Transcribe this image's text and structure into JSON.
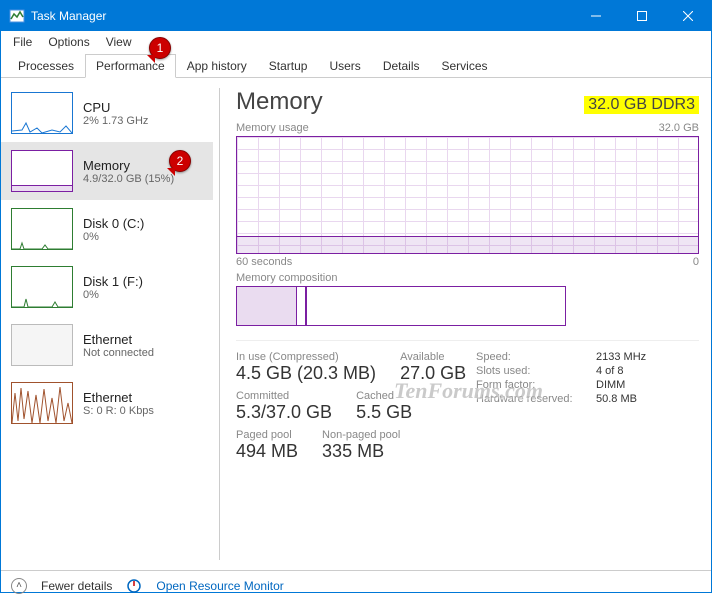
{
  "window": {
    "title": "Task Manager"
  },
  "menus": [
    "File",
    "Options",
    "View"
  ],
  "tabs": [
    "Processes",
    "Performance",
    "App history",
    "Startup",
    "Users",
    "Details",
    "Services"
  ],
  "active_tab": 1,
  "sidebar": [
    {
      "name": "CPU",
      "sub": "2% 1.73 GHz",
      "color": "blue"
    },
    {
      "name": "Memory",
      "sub": "4.9/32.0 GB (15%)",
      "color": "purple",
      "selected": true
    },
    {
      "name": "Disk 0 (C:)",
      "sub": "0%",
      "color": "green"
    },
    {
      "name": "Disk 1 (F:)",
      "sub": "0%",
      "color": "green"
    },
    {
      "name": "Ethernet",
      "sub": "Not connected",
      "color": "gray"
    },
    {
      "name": "Ethernet",
      "sub": "S: 0 R: 0 Kbps",
      "color": "orange"
    }
  ],
  "main": {
    "title": "Memory",
    "capacity": "32.0 GB DDR3",
    "usage_label": "Memory usage",
    "usage_max": "32.0 GB",
    "axis_left": "60 seconds",
    "axis_right": "0",
    "composition_label": "Memory composition"
  },
  "stats": {
    "inuse_label": "In use (Compressed)",
    "inuse_val": "4.5 GB (20.3 MB)",
    "available_label": "Available",
    "available_val": "27.0 GB",
    "committed_label": "Committed",
    "committed_val": "5.3/37.0 GB",
    "cached_label": "Cached",
    "cached_val": "5.5 GB",
    "paged_label": "Paged pool",
    "paged_val": "494 MB",
    "nonpaged_label": "Non-paged pool",
    "nonpaged_val": "335 MB"
  },
  "info": {
    "speed_k": "Speed:",
    "speed_v": "2133 MHz",
    "slots_k": "Slots used:",
    "slots_v": "4 of 8",
    "form_k": "Form factor:",
    "form_v": "DIMM",
    "hw_k": "Hardware reserved:",
    "hw_v": "50.8 MB"
  },
  "bottom": {
    "fewer": "Fewer details",
    "resmon": "Open Resource Monitor"
  },
  "callouts": {
    "c1": "1",
    "c2": "2"
  },
  "watermark": "TenForums.com"
}
